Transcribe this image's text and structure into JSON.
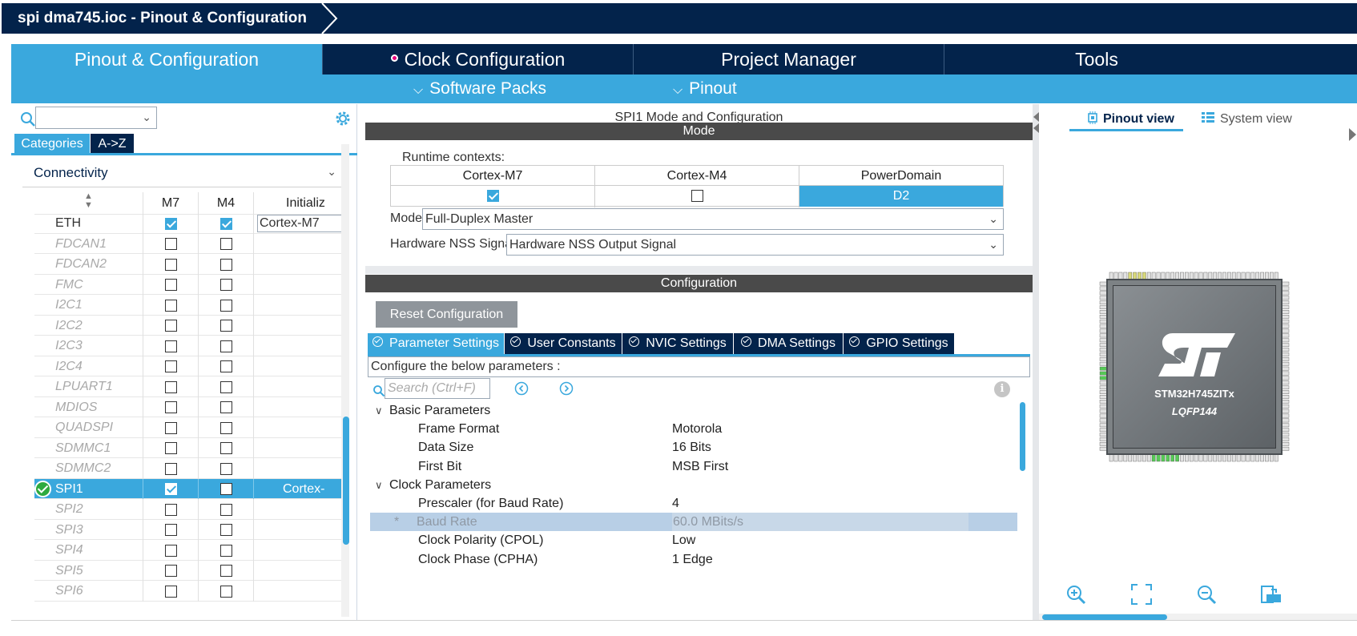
{
  "window": {
    "title": "spi dma745.ioc - Pinout & Configuration"
  },
  "main_tabs": [
    {
      "label": "Pinout & Configuration"
    },
    {
      "label": "Clock Configuration"
    },
    {
      "label": "Project Manager"
    },
    {
      "label": "Tools"
    }
  ],
  "sub_tabs": [
    {
      "label": "Software Packs"
    },
    {
      "label": "Pinout"
    }
  ],
  "left": {
    "category_tabs": [
      "Categories",
      "A->Z"
    ],
    "group": "Connectivity",
    "columns": [
      "M7",
      "M4",
      "Initializ"
    ],
    "rows": [
      {
        "name": "ETH",
        "enabled": true,
        "m7": true,
        "m4": true,
        "init": "Cortex-M7"
      },
      {
        "name": "FDCAN1",
        "enabled": false,
        "m7": false,
        "m4": false,
        "init": ""
      },
      {
        "name": "FDCAN2",
        "enabled": false,
        "m7": false,
        "m4": false,
        "init": ""
      },
      {
        "name": "FMC",
        "enabled": false,
        "m7": false,
        "m4": false,
        "init": ""
      },
      {
        "name": "I2C1",
        "enabled": false,
        "m7": false,
        "m4": false,
        "init": ""
      },
      {
        "name": "I2C2",
        "enabled": false,
        "m7": false,
        "m4": false,
        "init": ""
      },
      {
        "name": "I2C3",
        "enabled": false,
        "m7": false,
        "m4": false,
        "init": ""
      },
      {
        "name": "I2C4",
        "enabled": false,
        "m7": false,
        "m4": false,
        "init": ""
      },
      {
        "name": "LPUART1",
        "enabled": false,
        "m7": false,
        "m4": false,
        "init": ""
      },
      {
        "name": "MDIOS",
        "enabled": false,
        "m7": false,
        "m4": false,
        "init": ""
      },
      {
        "name": "QUADSPI",
        "enabled": false,
        "m7": false,
        "m4": false,
        "init": ""
      },
      {
        "name": "SDMMC1",
        "enabled": false,
        "m7": false,
        "m4": false,
        "init": ""
      },
      {
        "name": "SDMMC2",
        "enabled": false,
        "m7": false,
        "m4": false,
        "init": ""
      },
      {
        "name": "SPI1",
        "enabled": true,
        "selected": true,
        "m7": true,
        "m4": false,
        "init": "Cortex-"
      },
      {
        "name": "SPI2",
        "enabled": false,
        "m7": false,
        "m4": false,
        "init": ""
      },
      {
        "name": "SPI3",
        "enabled": false,
        "m7": false,
        "m4": false,
        "init": ""
      },
      {
        "name": "SPI4",
        "enabled": false,
        "m7": false,
        "m4": false,
        "init": ""
      },
      {
        "name": "SPI5",
        "enabled": false,
        "m7": false,
        "m4": false,
        "init": ""
      },
      {
        "name": "SPI6",
        "enabled": false,
        "m7": false,
        "m4": false,
        "init": ""
      }
    ]
  },
  "center": {
    "title": "SPI1 Mode and Configuration",
    "mode_header": "Mode",
    "runtime_label": "Runtime contexts:",
    "contexts": [
      {
        "header": "Cortex-M7",
        "checked": true
      },
      {
        "header": "Cortex-M4",
        "checked": false
      },
      {
        "header": "PowerDomain",
        "value": "D2"
      }
    ],
    "mode_label": "Mode",
    "mode_value": "Full-Duplex Master",
    "nss_label": "Hardware NSS Signal",
    "nss_value": "Hardware NSS Output Signal",
    "config_header": "Configuration",
    "reset_label": "Reset Configuration",
    "config_tabs": [
      "Parameter Settings",
      "User Constants",
      "NVIC Settings",
      "DMA Settings",
      "GPIO Settings"
    ],
    "description": "Configure the below parameters :",
    "search_placeholder": "Search (Ctrl+F)",
    "groups": [
      {
        "name": "Basic Parameters",
        "params": [
          {
            "name": "Frame Format",
            "value": "Motorola"
          },
          {
            "name": "Data Size",
            "value": "16 Bits"
          },
          {
            "name": "First Bit",
            "value": "MSB First"
          }
        ]
      },
      {
        "name": "Clock Parameters",
        "params": [
          {
            "name": "Prescaler (for Baud Rate)",
            "value": "4"
          },
          {
            "name": "Baud Rate",
            "value": "60.0 MBits/s",
            "readonly": true,
            "star": "*"
          },
          {
            "name": "Clock Polarity (CPOL)",
            "value": "Low"
          },
          {
            "name": "Clock Phase (CPHA)",
            "value": "1 Edge"
          }
        ]
      }
    ]
  },
  "right": {
    "view_tabs": [
      "Pinout view",
      "System view"
    ],
    "chip_part": "STM32H745ZITx",
    "chip_package": "LQFP144"
  },
  "colors": {
    "navy": "#03234b",
    "accent": "#3aa8dd",
    "dark_header": "#4a4a4a",
    "ok": "#2eaa3f"
  }
}
